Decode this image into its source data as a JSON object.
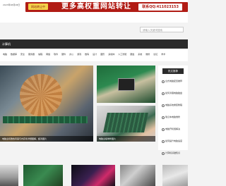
{
  "header": {
    "date": "2023年08月28日",
    "banner_badge": "网站转让中",
    "banner_headline": "更多高权重网站转让",
    "banner_contact": "联系QQ:411023153"
  },
  "search": {
    "placeholder": "请输入关键词搜索"
  },
  "nav": {
    "title": "计算机"
  },
  "categories": [
    "电脑",
    "数据库",
    "安全",
    "服务器",
    "编程",
    "网络",
    "软件",
    "硬件",
    "办公",
    "游戏",
    "数码",
    "设计",
    "图形",
    "多媒体",
    "人工智能",
    "硬盘",
    "系统",
    "维修",
    "论坛",
    "学术"
  ],
  "hero": {
    "caption": "电脑主机散热风扇与内存条详细图解，超清图片"
  },
  "thumbs": [
    {
      "caption": ""
    },
    {
      "caption": "电脑主板维修图片"
    }
  ],
  "hot": {
    "heading": "热文推荐",
    "items": [
      "台式电脑配置推荐",
      "如何清理电脑磁盘",
      "电脑系统重装教程",
      "笔记本电脑维修",
      "电脑开机慢解决",
      "如何提升电脑速度",
      "计算机基础知识"
    ]
  },
  "colors": {
    "banner": "#b11c15",
    "navbar": "#2b2b2b",
    "badge": "#f3d24a"
  }
}
